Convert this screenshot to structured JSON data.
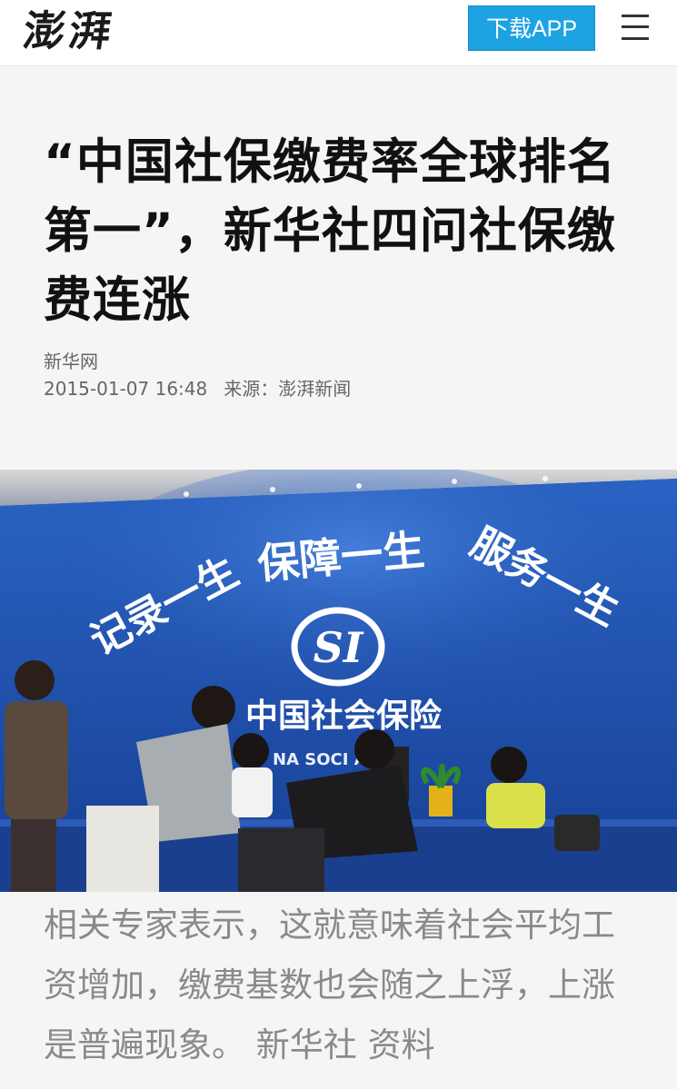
{
  "header": {
    "logo": "澎湃",
    "download_label": "下载APP",
    "menu_icon": "hamburger-menu-icon"
  },
  "article": {
    "title": "“中国社保缴费率全球排名第一”，新华社四问社保缴费连涨",
    "source": "新华网",
    "datetime": "2015-01-07 16:48",
    "origin_label": "来源：澎湃新闻"
  },
  "photo": {
    "wall_slogan_left": "记录一生",
    "wall_slogan_mid": "保障一生",
    "wall_slogan_right": "服务一生",
    "logo_text": "SI",
    "institution_name": "中国社会保险",
    "institution_name_en": "NA SOCI        ANCE"
  },
  "caption": "相关专家表示，这就意味着社会平均工资增加，缴费基数也会随之上浮，上涨是普遍现象。 新华社 资料",
  "colors": {
    "accent": "#1ea3e2",
    "wall_blue": "#1f4fa8"
  }
}
